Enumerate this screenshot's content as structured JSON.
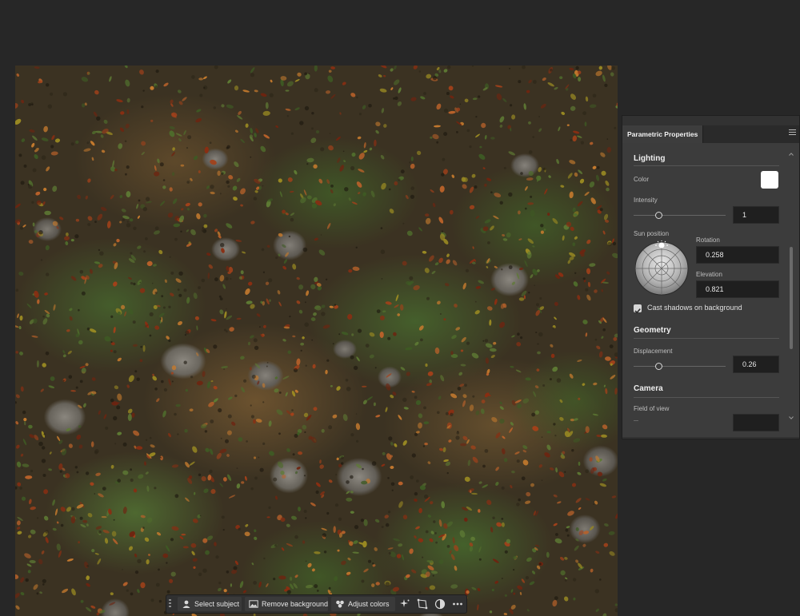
{
  "panel": {
    "tab_title": "Parametric Properties",
    "lighting": {
      "title": "Lighting",
      "color_label": "Color",
      "color_value": "#ffffff",
      "intensity_label": "Intensity",
      "intensity_value": "1",
      "intensity_fraction": 0.27,
      "sun_position_label": "Sun position",
      "rotation_label": "Rotation",
      "rotation_value": "0.258",
      "elevation_label": "Elevation",
      "elevation_value": "0.821",
      "cast_shadows_label": "Cast shadows on background",
      "cast_shadows_checked": true
    },
    "geometry": {
      "title": "Geometry",
      "displacement_label": "Displacement",
      "displacement_value": "0.26",
      "displacement_fraction": 0.27
    },
    "camera": {
      "title": "Camera",
      "fov_label": "Field of view"
    }
  },
  "taskbar": {
    "select_subject": "Select subject",
    "remove_background": "Remove background",
    "adjust_colors": "Adjust colors"
  },
  "icons": {
    "header": [
      "collapse-icon",
      "close-icon"
    ],
    "taskbar": [
      "person-icon",
      "image-icon",
      "palette-icon",
      "sparkle-icon",
      "transform-icon",
      "mask-icon",
      "more-icon"
    ]
  }
}
